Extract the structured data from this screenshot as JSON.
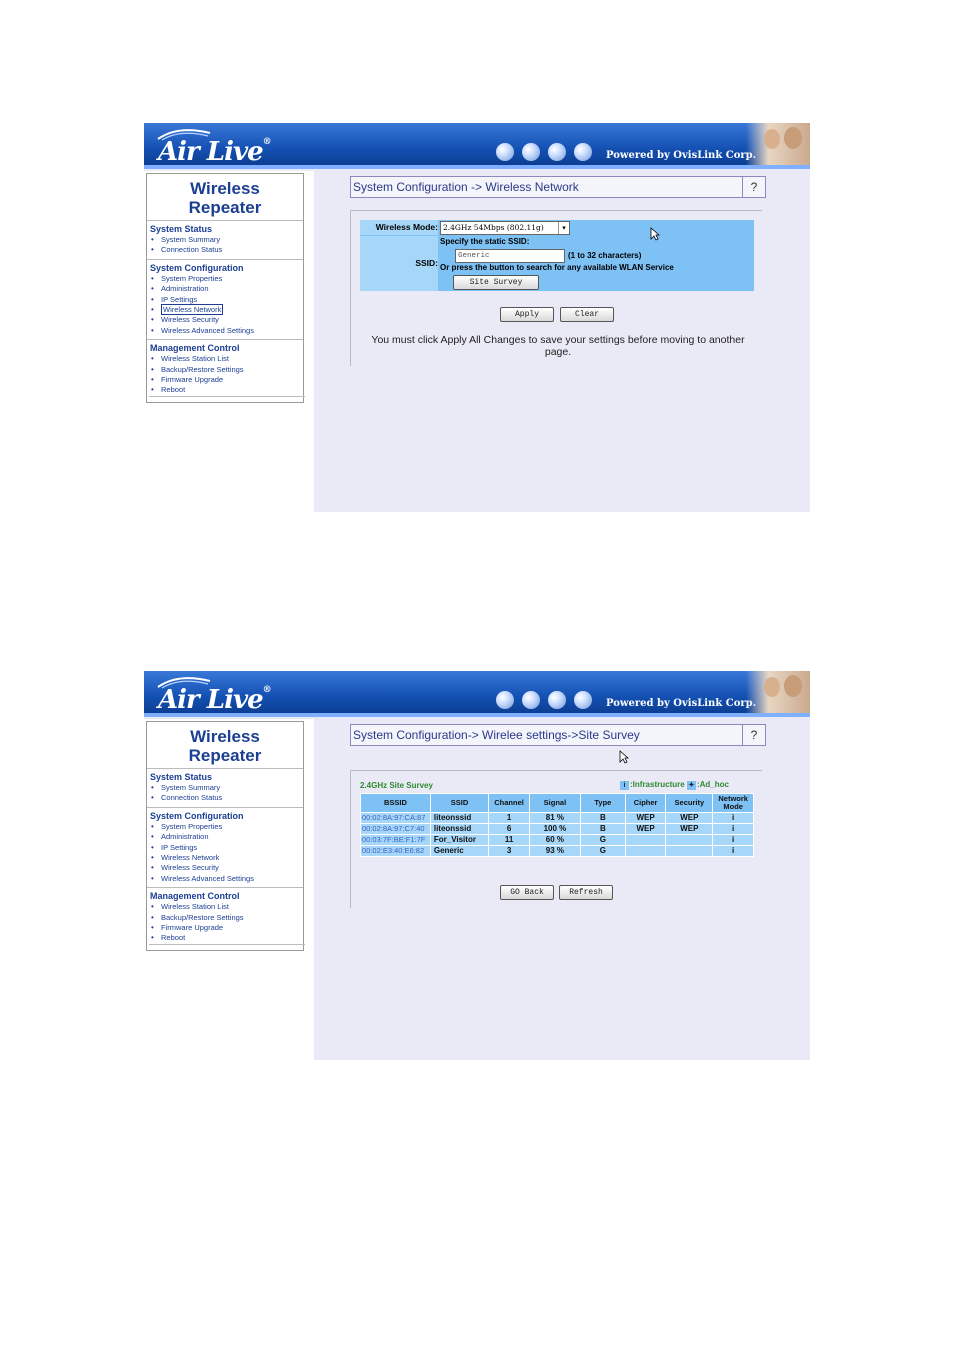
{
  "common": {
    "logo_text": "Air Live",
    "logo_reg": "®",
    "powered_text": "Powered by OvisLink Corp.",
    "sidebar": {
      "title_line1": "Wireless",
      "title_line2": "Repeater",
      "section_status": "System Status",
      "status_items": [
        "System Summary",
        "Connection Status"
      ],
      "section_config": "System Configuration",
      "config_items": [
        "System Properties",
        "Administration",
        "IP Settings",
        "Wireless Network",
        "Wireless Security",
        "Wireless Advanced Settings"
      ],
      "section_mgmt": "Management Control",
      "mgmt_items": [
        "Wireless Station List",
        "Backup/Restore Settings",
        "Firmware Upgrade",
        "Reboot"
      ]
    },
    "help": "?"
  },
  "screen1": {
    "title": "System Configuration -> Wireless Network",
    "wireless_mode_label": "Wireless Mode:",
    "wireless_mode_value": "2.4GHz 54Mbps (802.11g)",
    "ssid_label": "SSID:",
    "specify_text": "Specify the static SSID:",
    "ssid_value": "Generic",
    "ssid_range": "(1 to 32 characters)",
    "or_press_text": "Or press the button to search for any available WLAN Service",
    "site_survey_button": "Site Survey",
    "apply_button": "Apply",
    "clear_button": "Clear",
    "notice": "You must click Apply All Changes to save your settings before moving to another page."
  },
  "screen2": {
    "title": "System Configuration-> Wirelee settings->Site Survey",
    "survey_heading": "2.4GHz Site Survey",
    "legend_infra": ":Infrastructure",
    "legend_adhoc": ":Ad_hoc",
    "columns": [
      "BSSID",
      "SSID",
      "Channel",
      "Signal",
      "Type",
      "Cipher",
      "Security",
      "Network Mode"
    ],
    "rows": [
      [
        "00:02:8A:97:CA:87",
        "liteonssid",
        "1",
        "81 %",
        "B",
        "WEP",
        "WEP",
        "i"
      ],
      [
        "00:02:8A:97:C7:40",
        "liteonssid",
        "6",
        "100 %",
        "B",
        "WEP",
        "WEP",
        "i"
      ],
      [
        "00:03:7F:BE:F1:7F",
        "For_Visitor",
        "11",
        "60 %",
        "G",
        "",
        "",
        "i"
      ],
      [
        "00:02:E3:40:E6:82",
        "Generic",
        "3",
        "93 %",
        "G",
        "",
        "",
        "i"
      ]
    ],
    "go_back_button": "GO Back",
    "refresh_button": "Refresh"
  }
}
